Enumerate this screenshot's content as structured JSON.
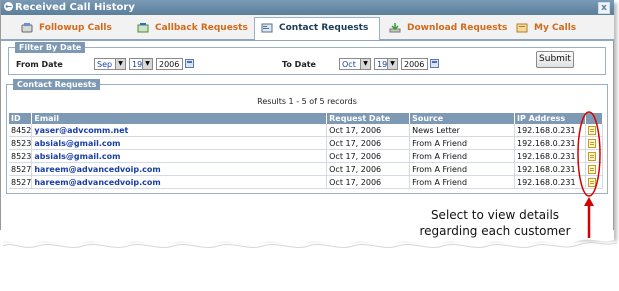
{
  "window": {
    "title": "Received Call History",
    "close_glyph": "x"
  },
  "tabs": [
    {
      "label": "Followup Calls",
      "icon": "phone-icon",
      "active": false
    },
    {
      "label": "Callback Requests",
      "icon": "callback-icon",
      "active": false
    },
    {
      "label": "Contact Requests",
      "icon": "contact-card-icon",
      "active": true
    },
    {
      "label": "Download Requests",
      "icon": "download-icon",
      "active": false
    },
    {
      "label": "My Calls",
      "icon": "my-calls-icon",
      "active": false
    }
  ],
  "filter": {
    "legend": "Filter By Date",
    "from_label": "From Date",
    "from_month": "Sep",
    "from_day": "19",
    "from_year": "2006",
    "to_label": "To Date",
    "to_month": "Oct",
    "to_day": "19",
    "to_year": "2006",
    "submit_label": "Submit"
  },
  "requests": {
    "legend": "Contact Requests",
    "results_text": "Results 1 - 5 of 5 records",
    "columns": [
      "ID",
      "Email",
      "Request Date",
      "Source",
      "IP Address"
    ],
    "rows": [
      {
        "id": "8452",
        "email": "yaser@advcomm.net",
        "date": "Oct 17, 2006",
        "source": "News Letter",
        "ip": "192.168.0.231"
      },
      {
        "id": "8523",
        "email": "absials@gmail.com",
        "date": "Oct 17, 2006",
        "source": "From A Friend",
        "ip": "192.168.0.231"
      },
      {
        "id": "8523",
        "email": "absials@gmail.com",
        "date": "Oct 17, 2006",
        "source": "From A Friend",
        "ip": "192.168.0.231"
      },
      {
        "id": "8527",
        "email": "hareem@advancedvoip.com",
        "date": "Oct 17, 2006",
        "source": "From A Friend",
        "ip": "192.168.0.231"
      },
      {
        "id": "8527",
        "email": "hareem@advancedvoip.com",
        "date": "Oct 17, 2006",
        "source": "From A Friend",
        "ip": "192.168.0.231"
      }
    ]
  },
  "annotation": {
    "line1": "Select to view details",
    "line2": "regarding each customer",
    "color": "#d40000"
  },
  "colors": {
    "tab_text": "#d26a1b",
    "header_bg": "#7d99b3",
    "link": "#1a3ea8"
  }
}
